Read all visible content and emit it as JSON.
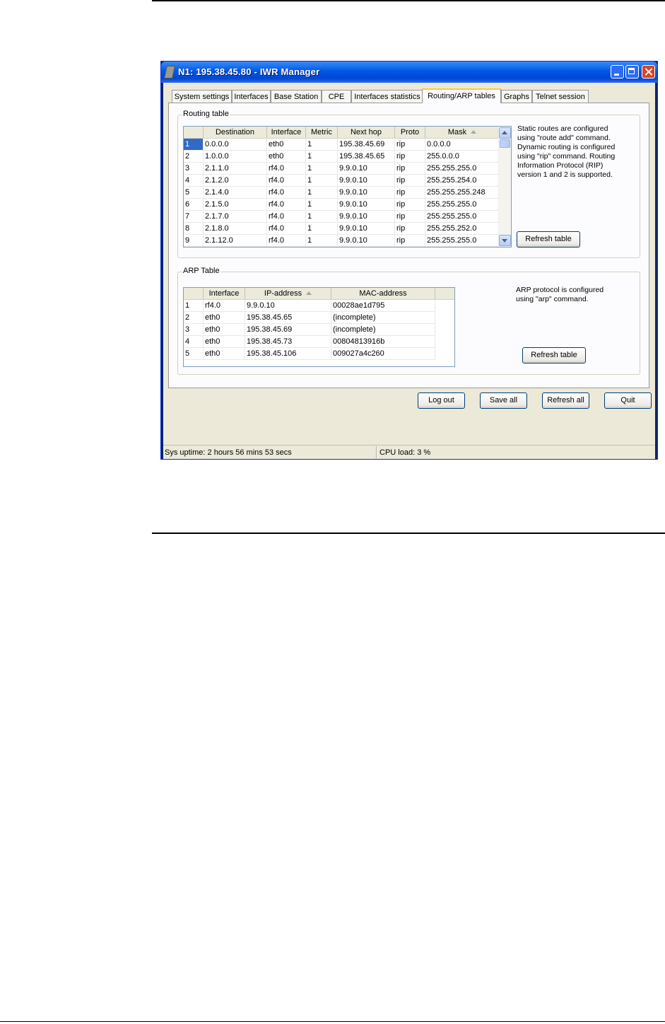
{
  "window": {
    "title": "N1: 195.38.45.80 - IWR Manager"
  },
  "tabs": [
    {
      "label": "System settings"
    },
    {
      "label": "Interfaces"
    },
    {
      "label": "Base Station"
    },
    {
      "label": "CPE"
    },
    {
      "label": "Interfaces statistics"
    },
    {
      "label": "Routing/ARP tables"
    },
    {
      "label": "Graphs"
    },
    {
      "label": "Telnet session"
    }
  ],
  "active_tab": "Routing/ARP tables",
  "routing": {
    "legend": "Routing table",
    "columns": [
      "",
      "Destination",
      "Interface",
      "Metric",
      "Next hop",
      "Proto",
      "Mask"
    ],
    "sorted_column": "Mask",
    "rows": [
      [
        "1",
        "0.0.0.0",
        "eth0",
        "1",
        "195.38.45.69",
        "rip",
        "0.0.0.0"
      ],
      [
        "2",
        "1.0.0.0",
        "eth0",
        "1",
        "195.38.45.65",
        "rip",
        "255.0.0.0"
      ],
      [
        "3",
        "2.1.1.0",
        "rf4.0",
        "1",
        "9.9.0.10",
        "rip",
        "255.255.255.0"
      ],
      [
        "4",
        "2.1.2.0",
        "rf4.0",
        "1",
        "9.9.0.10",
        "rip",
        "255.255.254.0"
      ],
      [
        "5",
        "2.1.4.0",
        "rf4.0",
        "1",
        "9.9.0.10",
        "rip",
        "255.255.255.248"
      ],
      [
        "6",
        "2.1.5.0",
        "rf4.0",
        "1",
        "9.9.0.10",
        "rip",
        "255.255.255.0"
      ],
      [
        "7",
        "2.1.7.0",
        "rf4.0",
        "1",
        "9.9.0.10",
        "rip",
        "255.255.255.0"
      ],
      [
        "8",
        "2.1.8.0",
        "rf4.0",
        "1",
        "9.9.0.10",
        "rip",
        "255.255.252.0"
      ],
      [
        "9",
        "2.1.12.0",
        "rf4.0",
        "1",
        "9.9.0.10",
        "rip",
        "255.255.255.0"
      ]
    ],
    "note_lines": [
      "Static routes are configured",
      "using \"route add\" command.",
      "Dynamic routing is configured",
      "using \"rip\" command. Routing",
      "Information Protocol (RIP)",
      "version 1 and 2 is supported."
    ],
    "refresh_label": "Refresh table"
  },
  "arp": {
    "legend": "ARP Table",
    "columns": [
      "",
      "Interface",
      "IP-address",
      "MAC-address"
    ],
    "sorted_column": "IP-address",
    "rows": [
      [
        "1",
        "rf4.0",
        "9.9.0.10",
        "00028ae1d795"
      ],
      [
        "2",
        "eth0",
        "195.38.45.65",
        "(incomplete)"
      ],
      [
        "3",
        "eth0",
        "195.38.45.69",
        "(incomplete)"
      ],
      [
        "4",
        "eth0",
        "195.38.45.73",
        "00804813916b"
      ],
      [
        "5",
        "eth0",
        "195.38.45.106",
        "009027a4c260"
      ]
    ],
    "note_lines": [
      "ARP protocol is configured",
      "using \"arp\" command."
    ],
    "refresh_label": "Refresh table"
  },
  "footer_buttons": {
    "logout": "Log out",
    "save_all": "Save all",
    "refresh_all": "Refresh all",
    "quit": "Quit"
  },
  "status": {
    "uptime": "Sys uptime: 2 hours 56 mins 53 secs",
    "cpu": "CPU load: 3 %"
  }
}
